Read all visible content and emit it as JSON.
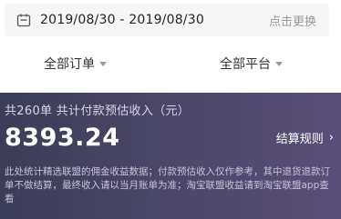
{
  "date_filter": {
    "icon": "calendar-icon",
    "range": "2019/08/30 - 2019/08/30",
    "change_label": "点击更换"
  },
  "filters": {
    "orders_label": "全部订单",
    "platform_label": "全部平台"
  },
  "summary": {
    "count_text": "共260单 共计付款预估收入（元）",
    "amount": "8393.24",
    "rules_label": "结算规则",
    "rules_chevron": "›",
    "note": "此处统计精选联盟的佣金收益数据；付款预估收入仅作参考，其中退货退款订单不做结算，最终收入请以当月账单为准；淘宝联盟收益请到淘宝联盟app查看"
  },
  "colors": {
    "panel_gradient_start": "#3b3d56",
    "panel_gradient_end": "#5a4f7a"
  }
}
